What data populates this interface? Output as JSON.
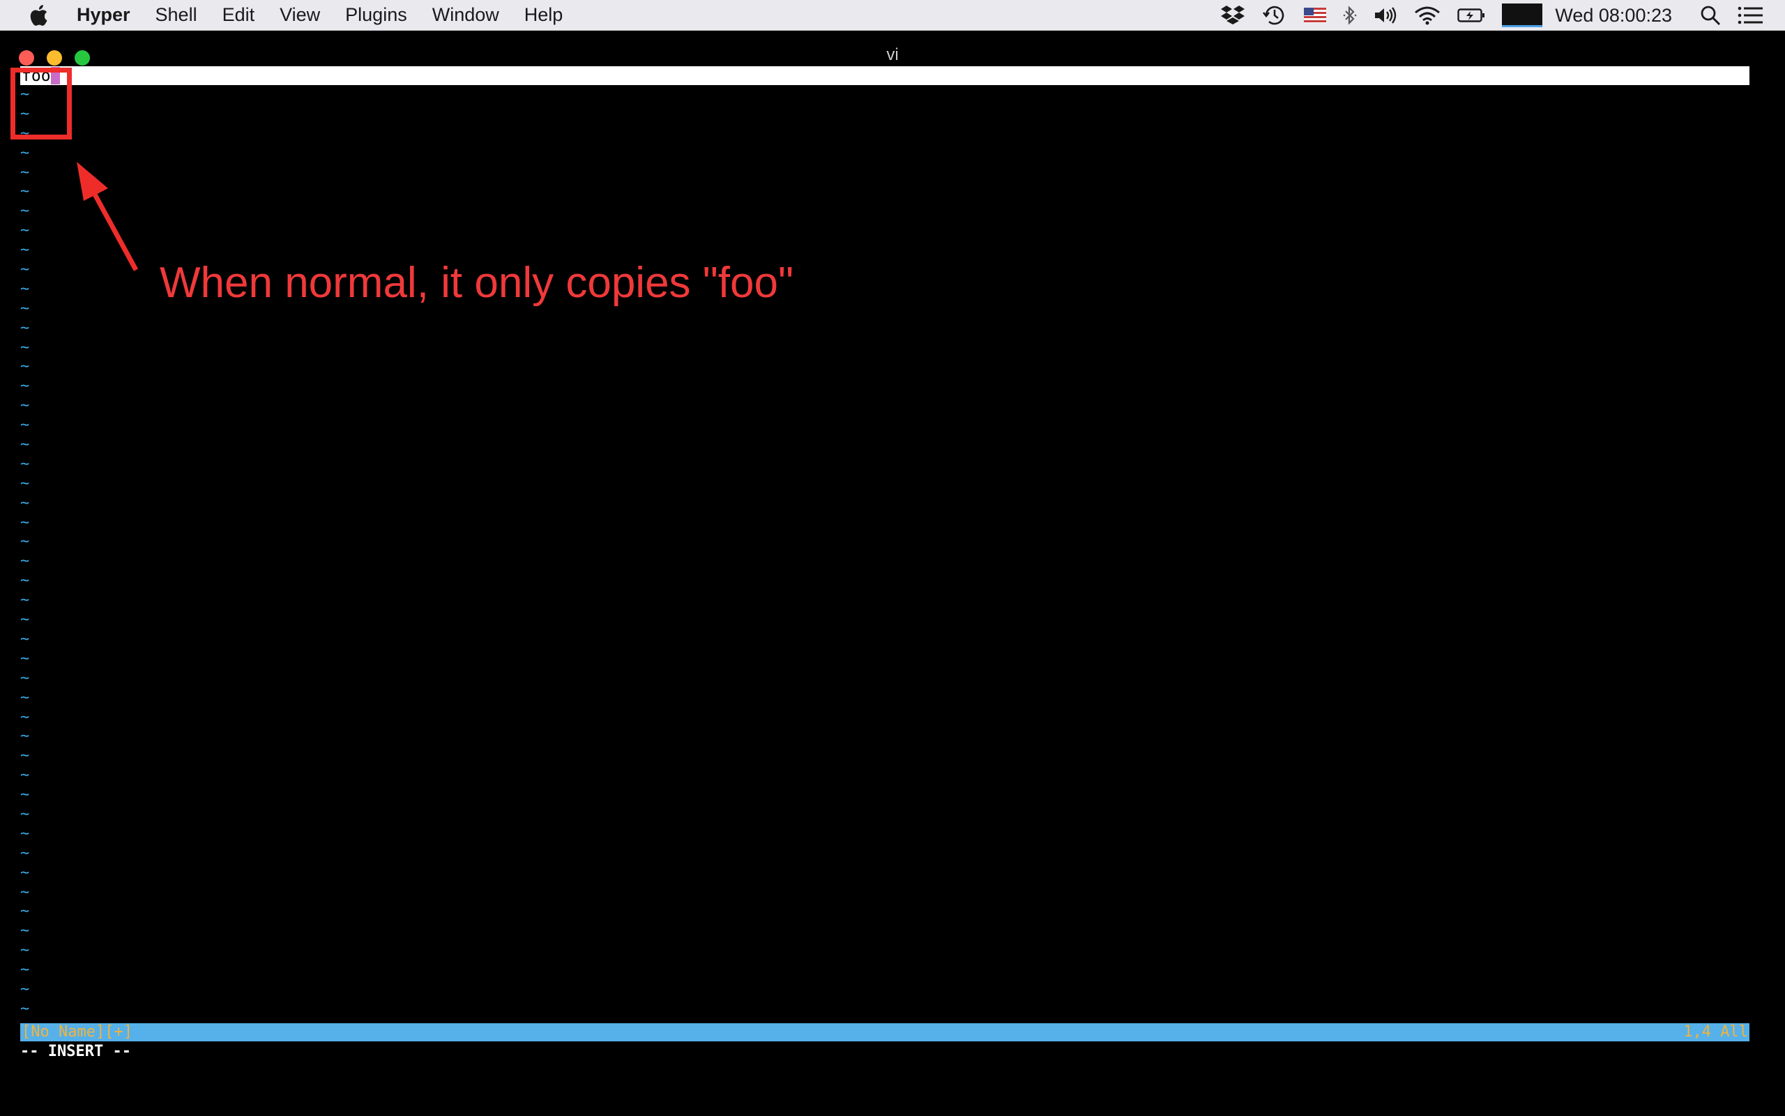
{
  "menubar": {
    "app_name": "Hyper",
    "items": [
      "Shell",
      "Edit",
      "View",
      "Plugins",
      "Window",
      "Help"
    ],
    "clock": "Wed 08:00:23",
    "status_icons": [
      "dropbox-icon",
      "time-machine-icon",
      "us-flag-icon",
      "bluetooth-icon",
      "volume-icon",
      "wifi-icon",
      "battery-icon",
      "activity-monitor-icon",
      "spotlight-icon",
      "notification-center-icon"
    ]
  },
  "window": {
    "title": "vi"
  },
  "editor": {
    "line1_text": "foo",
    "tilde": "~",
    "tilde_count": 48,
    "status_left": "[No Name][+]",
    "status_right": "1,4 All",
    "mode": "-- INSERT --"
  },
  "annotation": {
    "text": "When normal, it only copies \"foo\""
  },
  "colors": {
    "annotation": "#ee2d2a",
    "tilde": "#3aaae6",
    "statusline_bg": "#56b0ea",
    "statusline_fg": "#f0b43c",
    "cursor": "#c86cc7"
  }
}
